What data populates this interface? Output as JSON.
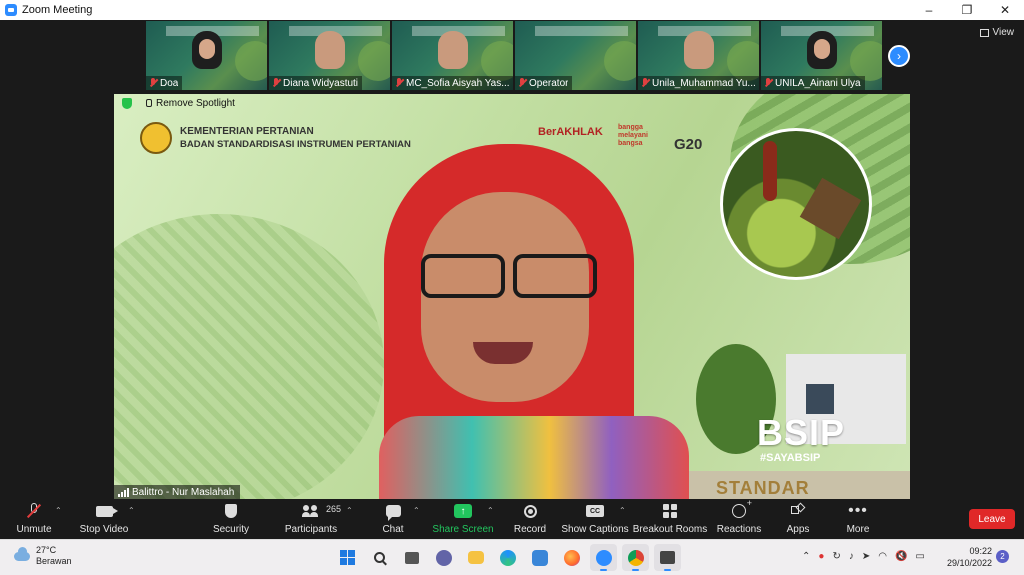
{
  "window": {
    "title": "Zoom Meeting"
  },
  "view": {
    "label": "View"
  },
  "thumbnails": [
    {
      "name": "Doa"
    },
    {
      "name": "Diana Widyastuti"
    },
    {
      "name": "MC_Sofia Aisyah Yas..."
    },
    {
      "name": "Operator"
    },
    {
      "name": "Unila_Muhammad Yu..."
    },
    {
      "name": "UNILA_Ainani Ulya"
    }
  ],
  "spotlight": {
    "remove_label": "Remove Spotlight"
  },
  "slide": {
    "ministry_line1": "KEMENTERIAN PERTANIAN",
    "ministry_line2": "BADAN STANDARDISASI INSTRUMEN PERTANIAN",
    "berakhlak": "BerAKHLAK",
    "bangga": "bangga melayani bangsa",
    "g20": "G20",
    "bsip": "BSIP",
    "hashtag": "#SAYABSIP",
    "standar": "STANDAR"
  },
  "speaker": {
    "name": "Balittro - Nur Maslahah"
  },
  "toolbar": {
    "unmute": "Unmute",
    "stop_video": "Stop Video",
    "security": "Security",
    "participants": "Participants",
    "participants_count": "265",
    "chat": "Chat",
    "share_screen": "Share Screen",
    "record": "Record",
    "show_captions": "Show Captions",
    "breakout_rooms": "Breakout Rooms",
    "reactions": "Reactions",
    "apps": "Apps",
    "more": "More",
    "leave": "Leave"
  },
  "taskbar": {
    "temp": "27°C",
    "weather": "Berawan",
    "time": "09:22",
    "date": "29/10/2022",
    "notifications": "2"
  },
  "colors": {
    "zoom_blue": "#2d8cff",
    "leave_red": "#e02828",
    "share_green": "#22c55e"
  }
}
